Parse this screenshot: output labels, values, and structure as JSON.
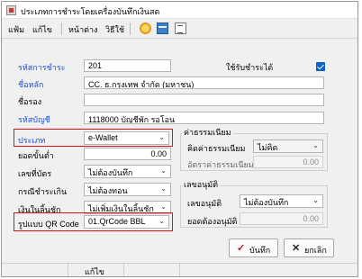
{
  "window": {
    "title": "ประเภทการชำระโดยเครื่องบันทึกเงินสด"
  },
  "menu": {
    "items": [
      "แฟ้ม",
      "แก้ไข",
      "หน้าต่าง",
      "วิธีใช้"
    ]
  },
  "toolbar": {
    "icons": [
      "help-icon",
      "card-icon",
      "document-icon"
    ]
  },
  "form": {
    "code_label": "รหัสการชำระ",
    "code_value": "201",
    "usable_label": "ใช้รับชำระได้",
    "usable_checked": true,
    "main_name_label": "ชื่อหลัก",
    "main_name_value": "CC. ธ.กรุงเทพ จำกัด (มหาชน)",
    "alt_name_label": "ชื่อรอง",
    "alt_name_value": "",
    "account_label": "รหัสบัญชี",
    "account_value": "1118000 บัญชีพัก รอโอน",
    "type_label": "ประเภท",
    "type_value": "e-Wallet",
    "min_amount_label": "ยอดขั้นต่ำ",
    "min_amount_value": "0.00",
    "card_no_label": "เลขที่บัตร",
    "card_no_value": "ไม่ต้องบันทึก",
    "change_label": "กรณีชำระเกิน",
    "change_value": "ไม่ต้องทอน",
    "excess_label": "เงินในลิ้นชัก",
    "excess_value": "ไม่เพิ่มเงินในลิ้นชัก",
    "qr_label": "รูปแบบ QR Code",
    "qr_value": "01.QrCode BBL"
  },
  "fee": {
    "group_title": "ค่าธรรมเนียม",
    "calc_label": "คิดค่าธรรมเนียม",
    "calc_value": "ไม่คิด",
    "rate_label": "อัตราค่าธรรมเนียม",
    "rate_value": "0.00"
  },
  "approval": {
    "group_title": "เลขอนุมัติ",
    "approval_label": "เลขอนุมัติ",
    "approval_value": "ไม่ต้องบันทึก",
    "amount_label": "ยอดต้องอนุมัติ",
    "amount_value": "0.00"
  },
  "buttons": {
    "save": "บันทึก",
    "cancel": "ยกเลิก"
  },
  "status": {
    "mode": "แก้ไข"
  },
  "colors": {
    "link_label": "#1f4fd1",
    "highlight_frame": "#e0101a",
    "checkbox": "#0b62c8"
  }
}
